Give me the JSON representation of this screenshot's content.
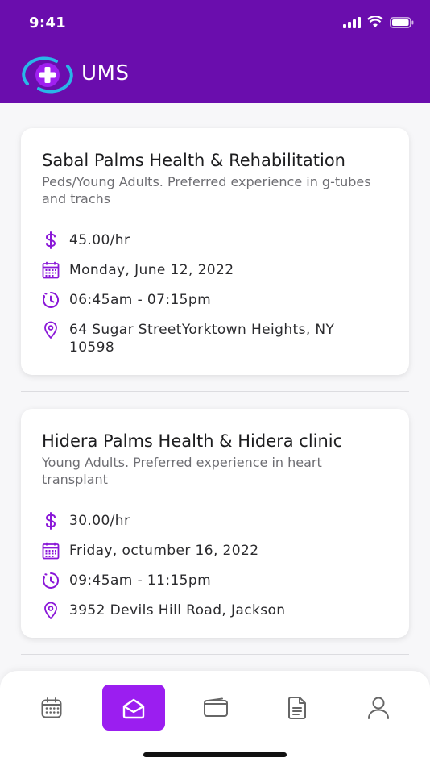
{
  "status_bar": {
    "time": "9:41"
  },
  "app": {
    "title": "UMS"
  },
  "colors": {
    "primary": "#6a0dad",
    "accent": "#9b1ef0",
    "icon": "#8a17d8"
  },
  "jobs": [
    {
      "title": "Sabal Palms Health & Rehabilitation",
      "description": "Peds/Young Adults. Preferred experience in g-tubes and trachs",
      "rate": "45.00/hr",
      "date": "Monday, June 12, 2022",
      "time": "06:45am - 07:15pm",
      "address": "64 Sugar StreetYorktown Heights, NY 10598"
    },
    {
      "title": "Hidera Palms Health & Hidera clinic",
      "description": "Young Adults. Preferred experience in heart transplant",
      "rate": "30.00/hr",
      "date": "Friday, octumber 16, 2022",
      "time": "09:45am - 11:15pm",
      "address": "3952 Devils Hill Road, Jackson"
    }
  ],
  "bottom_nav": [
    {
      "icon": "calendar-icon",
      "active": false
    },
    {
      "icon": "inbox-icon",
      "active": true
    },
    {
      "icon": "wallet-icon",
      "active": false
    },
    {
      "icon": "document-icon",
      "active": false
    },
    {
      "icon": "profile-icon",
      "active": false
    }
  ]
}
